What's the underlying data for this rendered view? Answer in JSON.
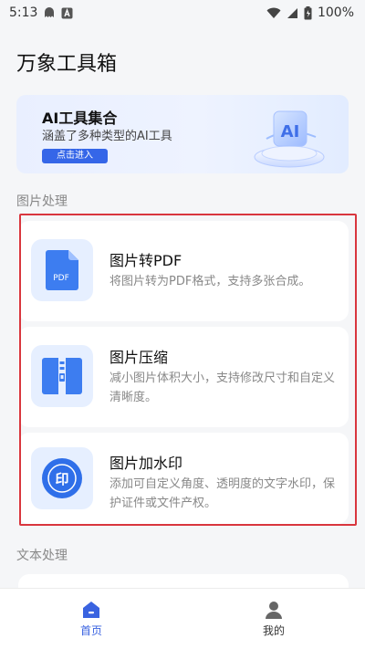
{
  "status_bar": {
    "time": "5:13",
    "battery": "100%"
  },
  "app": {
    "title": "万象工具箱"
  },
  "banner": {
    "title": "AI工具集合",
    "subtitle": "涵盖了多种类型的AI工具",
    "button": "点击进入",
    "art_label": "AI"
  },
  "sections": [
    {
      "label": "图片处理",
      "tools": [
        {
          "title": "图片转PDF",
          "desc": "将图片转为PDF格式，支持多张合成。",
          "icon": "pdf-file-icon",
          "icon_text": "PDF"
        },
        {
          "title": "图片压缩",
          "desc": "减小图片体积大小，支持修改尺寸和自定义清晰度。",
          "icon": "compress-icon"
        },
        {
          "title": "图片加水印",
          "desc": "添加可自定义角度、透明度的文字水印，保护证件或文件产权。",
          "icon": "stamp-icon",
          "icon_text": "印"
        }
      ]
    },
    {
      "label": "文本处理"
    }
  ],
  "bottom_nav": [
    {
      "label": "首页",
      "icon": "home-icon",
      "active": true
    },
    {
      "label": "我的",
      "icon": "user-icon",
      "active": false
    }
  ],
  "colors": {
    "accent": "#3566e8",
    "highlight_border": "#d9363e",
    "icon_bg": "#e6efff"
  }
}
